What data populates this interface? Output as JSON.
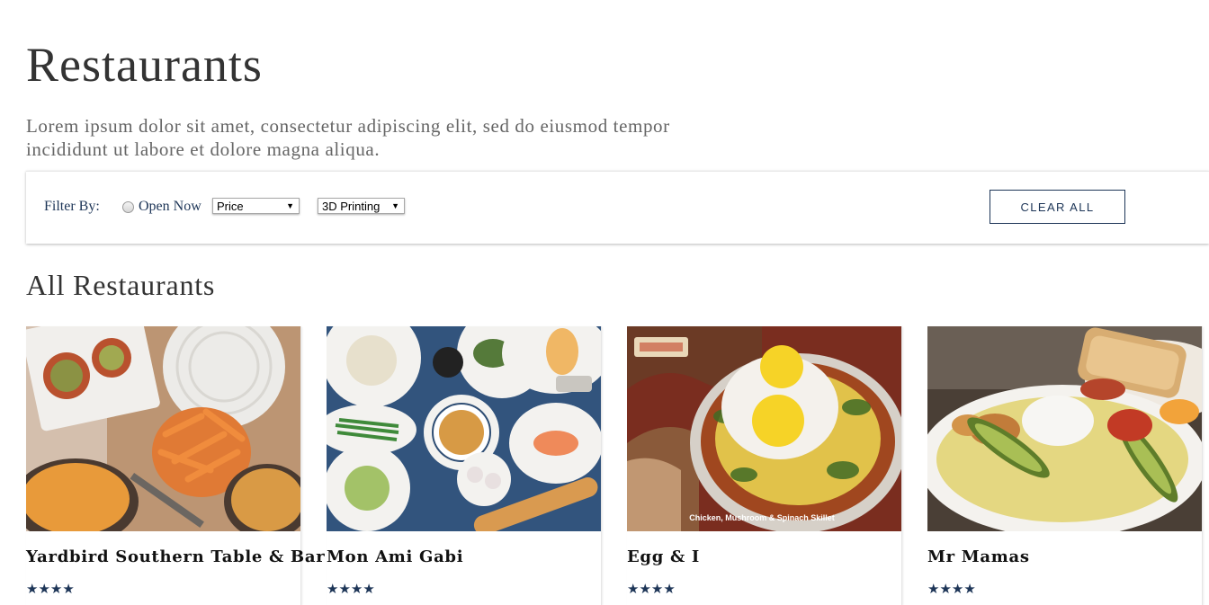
{
  "header": {
    "title": "Restaurants",
    "intro": "Lorem ipsum dolor sit amet, consectetur adipiscing elit, sed do eiusmod tempor incididunt ut labore et dolore magna aliqua."
  },
  "filters": {
    "label": "Filter By:",
    "open_now_label": "Open Now",
    "open_now_checked": false,
    "price_select": {
      "value": "Price",
      "arrow": "▼"
    },
    "category_select": {
      "value": "3D Printing",
      "arrow": "▼"
    },
    "clear_label": "CLEAR ALL"
  },
  "section": {
    "title": "All Restaurants"
  },
  "restaurants": [
    {
      "name": "Yardbird Southern Table & Bar",
      "stars": "★★★★",
      "rating": 4,
      "photo": "fried-chicken-and-fries-photo"
    },
    {
      "name": "Mon Ami Gabi",
      "stars": "★★★★",
      "rating": 4,
      "photo": "french-dishes-spread-photo"
    },
    {
      "name": "Egg & I",
      "stars": "★★★★",
      "rating": 4,
      "photo": "egg-skillet-photo",
      "photo_caption": "Chicken, Mushroom & Spinach Skillet"
    },
    {
      "name": "Mr Mamas",
      "stars": "★★★★",
      "rating": 4,
      "photo": "omelette-avocado-photo"
    }
  ],
  "colors": {
    "accent": "#1d3557",
    "heading": "#333333",
    "body_text": "#666666"
  }
}
